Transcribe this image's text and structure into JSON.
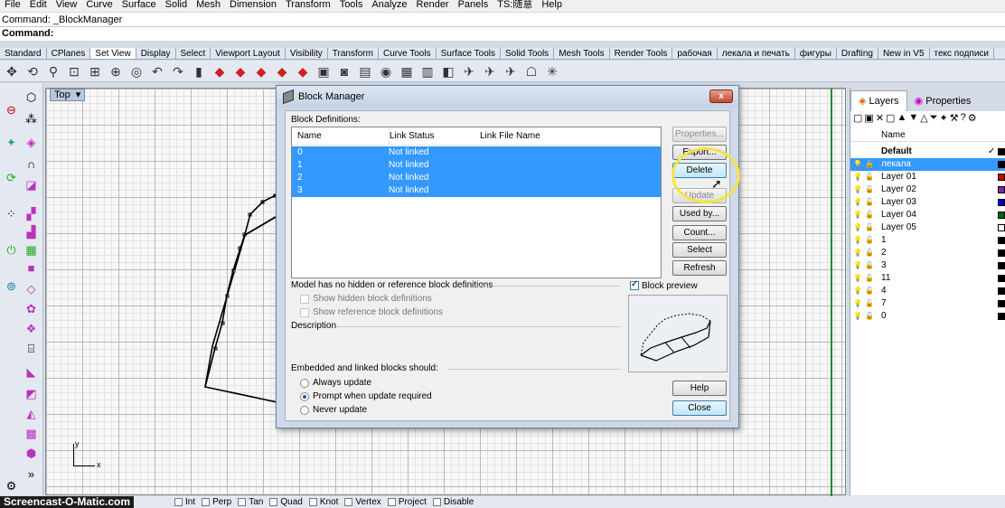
{
  "menu": [
    "File",
    "Edit",
    "View",
    "Curve",
    "Surface",
    "Solid",
    "Mesh",
    "Dimension",
    "Transform",
    "Tools",
    "Analyze",
    "Render",
    "Panels",
    "TS:随意",
    "Help"
  ],
  "command_history": "Command: _BlockManager",
  "command_prompt": "Command:",
  "toolbar_tabs": [
    "Standard",
    "CPlanes",
    "Set View",
    "Display",
    "Select",
    "Viewport Layout",
    "Visibility",
    "Transform",
    "Curve Tools",
    "Surface Tools",
    "Solid Tools",
    "Mesh Tools",
    "Render Tools",
    "рабочая",
    "лекала и печать",
    "фигуры",
    "Drafting",
    "New in V5",
    "текс подписи"
  ],
  "active_tab": "Set View",
  "viewport": {
    "label": "Top",
    "axis_y": "y",
    "axis_x": "x"
  },
  "right_panel": {
    "tabs": [
      "Layers",
      "Properties"
    ],
    "column_name": "Name",
    "layers": [
      {
        "name": "Default",
        "color": "#000000",
        "current": true
      },
      {
        "name": "лекала",
        "color": "#000000",
        "selected": true
      },
      {
        "name": "Layer 01",
        "color": "#cc0000"
      },
      {
        "name": "Layer 02",
        "color": "#7a2c9c"
      },
      {
        "name": "Layer 03",
        "color": "#0000cc"
      },
      {
        "name": "Layer 04",
        "color": "#006600"
      },
      {
        "name": "Layer 05",
        "color": "#ffffff"
      },
      {
        "name": "1",
        "color": "#000000"
      },
      {
        "name": "2",
        "color": "#000000"
      },
      {
        "name": "3",
        "color": "#000000"
      },
      {
        "name": "11",
        "color": "#000000"
      },
      {
        "name": "4",
        "color": "#000000"
      },
      {
        "name": "7",
        "color": "#000000"
      },
      {
        "name": "0",
        "color": "#000000"
      }
    ]
  },
  "dialog": {
    "title": "Block Manager",
    "close_label": "x",
    "block_definitions_label": "Block Definitions:",
    "columns": [
      "Name",
      "Link Status",
      "Link File Name"
    ],
    "rows": [
      {
        "name": "0",
        "link_status": "Not linked",
        "link_file": ""
      },
      {
        "name": "1",
        "link_status": "Not linked",
        "link_file": ""
      },
      {
        "name": "2",
        "link_status": "Not linked",
        "link_file": ""
      },
      {
        "name": "3",
        "link_status": "Not linked",
        "link_file": ""
      }
    ],
    "buttons": {
      "properties": "Properties...",
      "export": "Export...",
      "delete": "Delete",
      "update": "Update",
      "used_by": "Used by...",
      "count": "Count...",
      "select": "Select",
      "refresh": "Refresh",
      "help": "Help",
      "close": "Close"
    },
    "hidden_note": "Model has no hidden or reference block definitions",
    "show_hidden": "Show hidden block definitions",
    "show_reference": "Show reference block definitions",
    "description_label": "Description",
    "embedded_label": "Embedded and linked blocks should:",
    "radio_options": [
      "Always update",
      "Prompt when update required",
      "Never update"
    ],
    "radio_selected": "Prompt when update required",
    "block_preview_label": "Block preview",
    "block_preview_checked": true
  },
  "status_bar": {
    "brand": "Screencast-O-Matic.com",
    "snaps": [
      "Int",
      "Perp",
      "Tan",
      "Quad",
      "Knot",
      "Vertex",
      "Project",
      "Disable"
    ]
  }
}
